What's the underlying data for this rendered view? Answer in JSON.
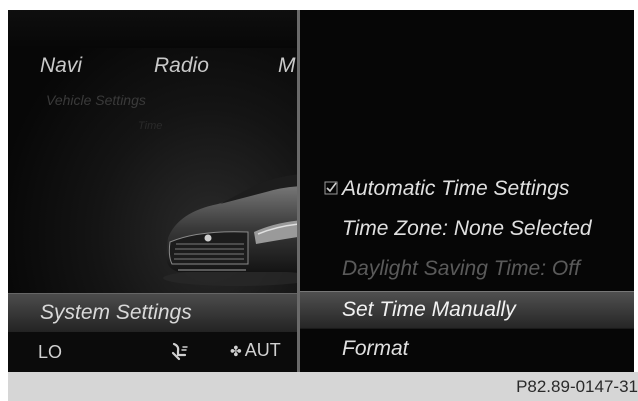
{
  "left_panel": {
    "main_menu": [
      "Navi",
      "Radio",
      "M"
    ],
    "sub_title": "Vehicle Settings",
    "sub_title_2": "Time",
    "selected_menu": "System Settings",
    "status_bar": {
      "temp_left": "LO",
      "seat_icon": "seat-airflow-icon",
      "fan_icon": "fan-icon",
      "fan_mode": "AUT"
    }
  },
  "right_panel": {
    "items": [
      {
        "label": "Automatic Time Settings",
        "checked": true
      },
      {
        "label": "Time Zone: None Selected"
      },
      {
        "label": "Daylight Saving Time: Off",
        "disabled": true
      },
      {
        "label": "Set Time Manually",
        "selected": true
      },
      {
        "label": "Format"
      }
    ]
  },
  "footer": {
    "reference": "P82.89-0147-31"
  },
  "colors": {
    "background": "#070707",
    "text": "#e0e0e0",
    "disabled_text": "#5a5a5a",
    "footer_bg": "#d6d6d6"
  }
}
